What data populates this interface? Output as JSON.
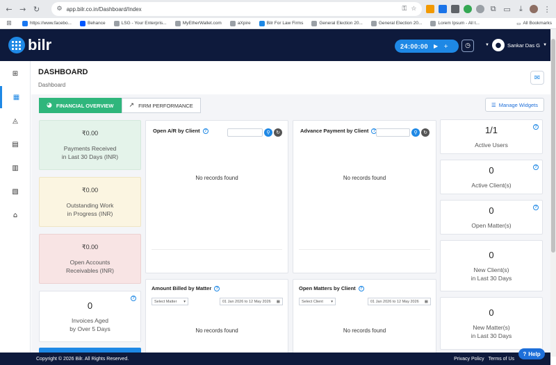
{
  "browser": {
    "url": "app.bilr.co.in/Dashboard/Index",
    "bookmarks": [
      "https://www.facebo...",
      "Behance",
      "LSG - Your Enterpris...",
      "MyEtherWallet.com",
      "aXpire",
      "Bilr For Law Firms",
      "General Election 20...",
      "General Election 20...",
      "Lorem Ipsum - All t..."
    ],
    "all_bookmarks": "All Bookmarks"
  },
  "header": {
    "logo_text": "bilr",
    "timer": "24:00:00",
    "user_name": "Sankar Das G"
  },
  "page": {
    "title": "DASHBOARD",
    "breadcrumb": "Dashboard"
  },
  "tabs": [
    {
      "label": "FINANCIAL OVERVIEW",
      "active": true
    },
    {
      "label": "FIRM PERFORMANCE",
      "active": false
    }
  ],
  "manage_widgets": "Manage Widgets",
  "stat_cards": [
    {
      "amount": "₹0.00",
      "label_line1": "Payments Received",
      "label_line2": "in Last 30 Days (INR)"
    },
    {
      "amount": "₹0.00",
      "label_line1": "Outstanding Work",
      "label_line2": "in Progress (INR)"
    },
    {
      "amount": "₹0.00",
      "label_line1": "Open Accounts",
      "label_line2": "Receivables (INR)"
    }
  ],
  "invoices_aged": {
    "count": "0",
    "label_line1": "Invoices Aged",
    "label_line2": "by Over 5 Days"
  },
  "widgets": {
    "open_ar": {
      "title": "Open A/R by Client",
      "empty": "No records found"
    },
    "advance_payment": {
      "title": "Advance Payment by Client",
      "empty": "No records found"
    },
    "amount_billed": {
      "title": "Amount Billed by Matter",
      "select": "Select Matter",
      "range": "01 Jan 2026 to 12 May 2026",
      "empty": "No records found"
    },
    "open_matters": {
      "title": "Open Matters by Client",
      "select": "Select Client",
      "range": "01 Jan 2026 to 12 May 2026",
      "empty": "No records found"
    }
  },
  "counts": [
    {
      "value": "1/1",
      "line1": "Active Users",
      "line2": ""
    },
    {
      "value": "0",
      "line1": "Active Client(s)",
      "line2": ""
    },
    {
      "value": "0",
      "line1": "Open Matter(s)",
      "line2": ""
    },
    {
      "value": "0",
      "line1": "New Client(s)",
      "line2": "in Last 30 Days"
    },
    {
      "value": "0",
      "line1": "New Matter(s)",
      "line2": "in Last 30 Days"
    }
  ],
  "footer": {
    "copyright": "Copyright © 2026 Bilr. All Rights Reserved.",
    "privacy": "Privacy Policy",
    "terms": "Terms of Us"
  },
  "help_label": "Help",
  "colors": {
    "brand_navy": "#0e1a3c",
    "accent_blue": "#1e88e5",
    "tab_green": "#2fb67c"
  }
}
